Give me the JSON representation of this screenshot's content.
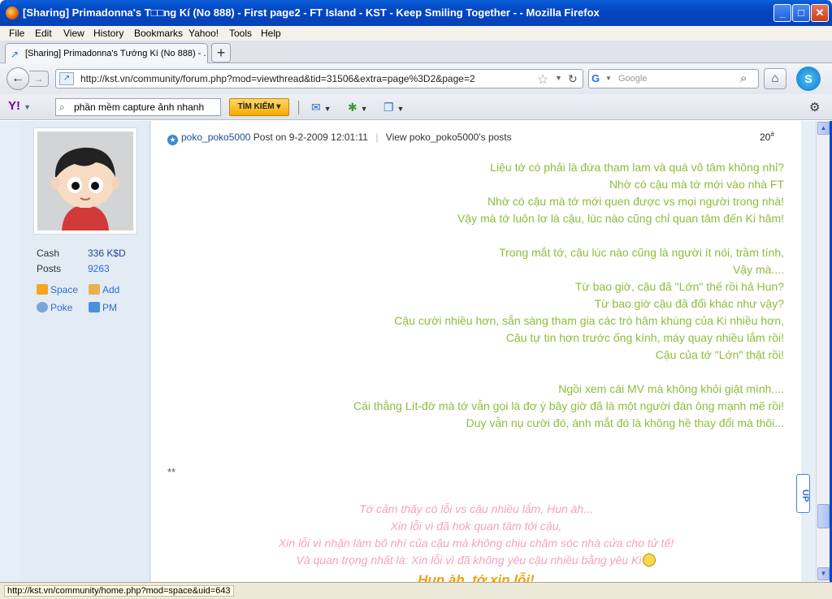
{
  "window": {
    "title": "[Sharing] Primadonna's T□□ng Kí (No 888) - First page2 - FT Island - KST - Keep Smiling Together - - Mozilla Firefox",
    "minimize": "_",
    "maximize": "□",
    "close": "✕"
  },
  "menu": [
    "File",
    "Edit",
    "View",
    "History",
    "Bookmarks",
    "Yahoo!",
    "Tools",
    "Help"
  ],
  "tab": {
    "label": "[Sharing] Primadonna's Tướng Kí (No 888) - ...",
    "new_tab": "+"
  },
  "nav": {
    "url": "http://kst.vn/community/forum.php?mod=viewthread&tid=31506&extra=page%3D2&page=2",
    "search_placeholder": "Google"
  },
  "yahoo": {
    "logo": "Y!",
    "search_value": "phần mềm capture ảnh nhanh",
    "search_button": "TÌM KIẾM ▾"
  },
  "profile": {
    "cash_label": "Cash",
    "cash_value": "336 K$D",
    "posts_label": "Posts",
    "posts_value": "9263",
    "space": "Space",
    "add": "Add",
    "poke": "Poke",
    "pm": "PM"
  },
  "post": {
    "author": "poko_poko5000",
    "posted": "Post on 9-2-2009 12:01:11",
    "view_posts": "View poko_poko5000's posts",
    "number": "20",
    "number_sup": "#",
    "green_lines": [
      "Liệu tớ có phải là đứa tham lam và quá vô tâm không nhỉ?",
      "Nhờ có cậu mà tớ mới vào nhà FT",
      "Nhờ có cậu mà tớ mới quen được vs mọi người trong nhà!",
      "Vậy mà tớ luôn lơ là cậu, lúc nào cũng chỉ quan tâm đến Ki hâm!",
      "Trong mắt tớ, cậu lúc nào cũng là người ít nói, trầm tính,",
      "Vậy mà....",
      "Từ bao giờ, cậu đã \"Lớn\" thế rồi hả Hun?",
      "Từ bao giờ cậu đã đổi khác như vậy?",
      "Cậu cười nhiều hơn, sẵn sàng tham gia các trò hâm khùng của Ki nhiều hơn,",
      "Cậu tự tin hơn trước ống kính, máy quay nhiều lắm rồi!",
      "Cậu của tớ \"Lớn\" thật rồi!",
      "Ngồi xem cái MV mà không khỏi giật mình....",
      "Cái thằng Lít-đờ mà tớ vẫn gọi là đơ ý bây giờ đã là một người đàn ông mạnh mẽ rồi!",
      "Duy vẫn nụ cười đó, ánh mắt đó là không hề thay đổi mà thôi..."
    ],
    "stars": "**",
    "pink_lines": [
      "Tớ cảm thấy có lỗi vs cậu nhiều lắm, Hun àh...",
      "Xin lỗi vì đã hok quan tâm tới cậu,",
      "Xin lỗi vì nhận làm bõ nhí của cậu mà không chịu chăm sóc nhà cửa cho tử tế!",
      "Và quan trọng nhất là: Xin lỗi vì đã không yêu cậu nhiều bằng yêu Ki"
    ],
    "orange_line": "Hun àh, tớ xin lỗi!"
  },
  "updock": "UP",
  "status": "http://kst.vn/community/home.php?mod=space&uid=643",
  "colors": {
    "green_text": "#8cbd3c",
    "pink_text": "#f6a2ba",
    "orange_text": "#f2a20d",
    "link": "#2a6fd0"
  }
}
